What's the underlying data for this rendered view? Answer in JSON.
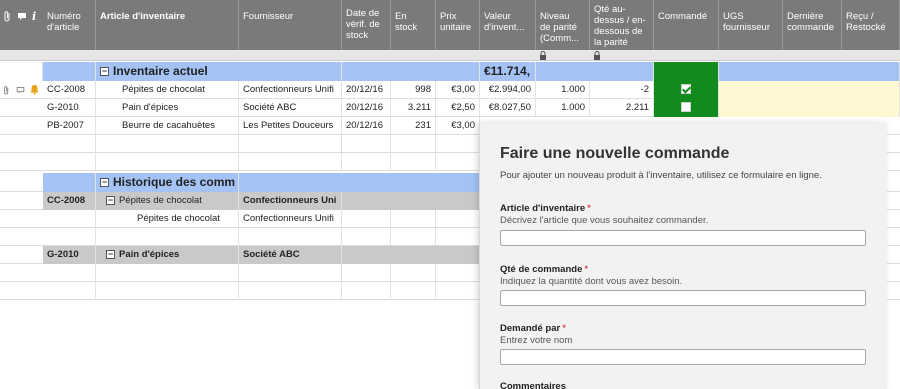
{
  "columns": [
    {
      "label": "Numéro\nd'article"
    },
    {
      "label": "Article d'inventaire"
    },
    {
      "label": "Fournisseur"
    },
    {
      "label": "Date de\nvérif. de\nstock"
    },
    {
      "label": "En\nstock"
    },
    {
      "label": "Prix\nunitaire"
    },
    {
      "label": "Valeur\nd'invent..."
    },
    {
      "label": "Niveau\nde parité\n(Comm..."
    },
    {
      "label": "Qté au-\ndessus / en-\ndessous de\nla parité"
    },
    {
      "label": "Commandé"
    },
    {
      "label": "UGS\nfournisseur"
    },
    {
      "label": "Dernière\ncommande"
    },
    {
      "label": "Reçu /\nRestocké"
    }
  ],
  "sections": {
    "current": {
      "title": "Inventaire actuel",
      "total": "€11.714,"
    },
    "history": {
      "title": "Historique des comm"
    }
  },
  "rows": [
    {
      "id": "CC-2008",
      "item": "Pépites de chocolat",
      "supplier": "Confectionneurs Unifi",
      "date": "20/12/16",
      "stock": "998",
      "price": "€3,00",
      "value": "€2.994,00",
      "par": "1.000",
      "diff": "-2",
      "ordered": true
    },
    {
      "id": "G-2010",
      "item": "Pain d'épices",
      "supplier": "Société ABC",
      "date": "20/12/16",
      "stock": "3.211",
      "price": "€2,50",
      "value": "€8.027,50",
      "par": "1.000",
      "diff": "2.211",
      "ordered": false
    },
    {
      "id": "PB-2007",
      "item": "Beurre de cacahuètes",
      "supplier": "Les Petites Douceurs",
      "date": "20/12/16",
      "stock": "231",
      "price": "€3,00",
      "value": "",
      "par": "",
      "diff": "",
      "ordered": false
    }
  ],
  "history": {
    "group1": {
      "id": "CC-2008",
      "item": "Pépites de chocolat",
      "supplier": "Confectionneurs Uni"
    },
    "group1_child": {
      "item": "Pépites de chocolat",
      "supplier": "Confectionneurs Unifi"
    },
    "group2": {
      "id": "G-2010",
      "item": "Pain d'épices",
      "supplier": "Société ABC"
    }
  },
  "form": {
    "title": "Faire une nouvelle commande",
    "subtitle": "Pour ajouter un nouveau produit à l'inventaire, utilisez ce formulaire en ligne.",
    "fields": [
      {
        "label": "Article d'inventaire",
        "help": "Décrivez l'article que vous souhaitez commander.",
        "value": ""
      },
      {
        "label": "Qté de commande",
        "help": "Indiquez la quantité dont vous avez besoin.",
        "value": ""
      },
      {
        "label": "Demandé par",
        "help": "Entrez votre nom",
        "value": ""
      },
      {
        "label": "Commentaires",
        "help": "",
        "value": ""
      }
    ],
    "required_mark": "*"
  },
  "colors": {
    "header": "#7a7a7a",
    "section": "#a4c2f4",
    "group": "#c9c9c9",
    "ordered_col": "#138a1e",
    "highlight": "#fdf8d2"
  }
}
